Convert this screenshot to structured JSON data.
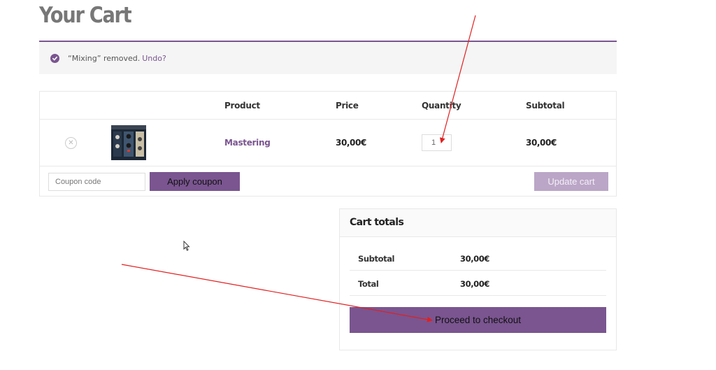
{
  "page": {
    "title": "Your Cart"
  },
  "notice": {
    "message": "“Mixing” removed.",
    "undo_label": "Undo?",
    "accent_color": "#7a5590",
    "icon": "check-circle-icon"
  },
  "cart": {
    "columns": [
      "",
      "",
      "Product",
      "Price",
      "Quantity",
      "Subtotal"
    ],
    "items": [
      {
        "name": "Mastering",
        "price": "30,00€",
        "quantity": "1",
        "subtotal": "30,00€",
        "remove_icon": "remove-x-icon"
      }
    ],
    "coupon_placeholder": "Coupon code",
    "apply_coupon_label": "Apply coupon",
    "update_cart_label": "Update cart"
  },
  "totals": {
    "title": "Cart totals",
    "rows": [
      {
        "label": "Subtotal",
        "value": "30,00€"
      },
      {
        "label": "Total",
        "value": "30,00€"
      }
    ],
    "checkout_label": "Proceed to checkout"
  },
  "colors": {
    "brand_purple": "#7a5590",
    "disabled_purple": "#bba6c7",
    "annotation_arrow": "#e02020"
  }
}
